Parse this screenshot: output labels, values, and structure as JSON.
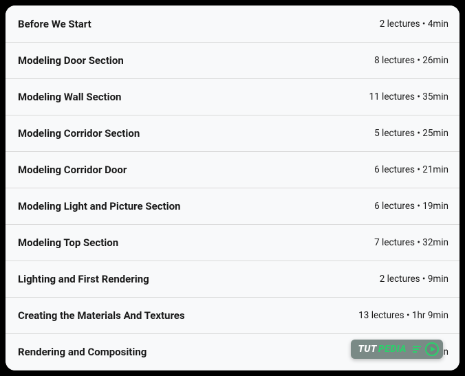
{
  "sections": [
    {
      "title": "Before We Start",
      "meta": "2 lectures • 4min"
    },
    {
      "title": "Modeling Door Section",
      "meta": "8 lectures • 26min"
    },
    {
      "title": "Modeling Wall Section",
      "meta": "11 lectures • 35min"
    },
    {
      "title": "Modeling Corridor Section",
      "meta": "5 lectures • 25min"
    },
    {
      "title": "Modeling Corridor Door",
      "meta": "6 lectures • 21min"
    },
    {
      "title": "Modeling Light and Picture Section",
      "meta": "6 lectures • 19min"
    },
    {
      "title": "Modeling Top Section",
      "meta": "7 lectures • 32min"
    },
    {
      "title": "Lighting and First Rendering",
      "meta": "2 lectures • 9min"
    },
    {
      "title": "Creating the Materials And Textures",
      "meta": "13 lectures • 1hr 9min"
    },
    {
      "title": "Rendering and Compositing",
      "meta": "3 lectures • 11min"
    }
  ],
  "badge": {
    "tut": "TUT",
    "pedia": "PEDIA"
  }
}
